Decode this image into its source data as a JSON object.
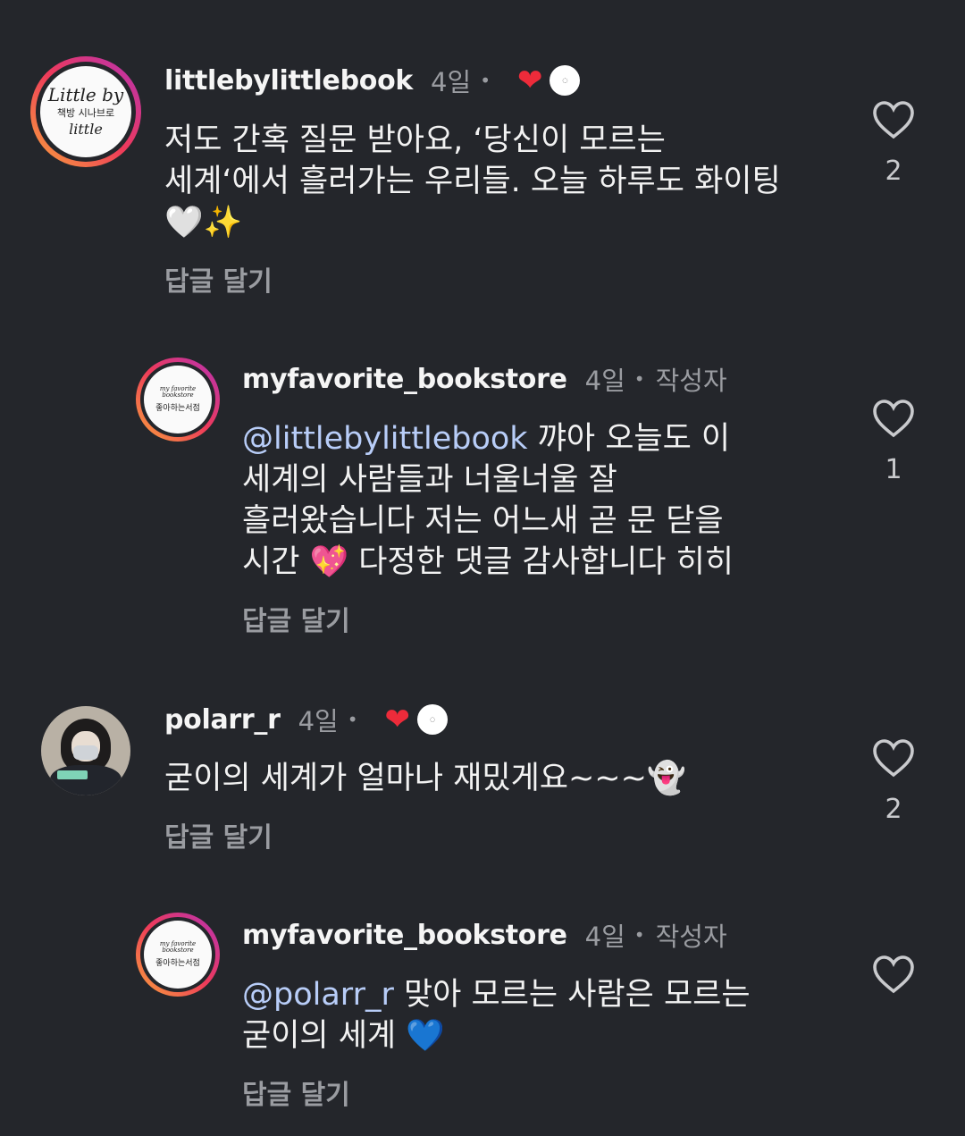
{
  "comments": [
    {
      "username": "littlebylittlebook",
      "time": "4일",
      "liked_by_author": true,
      "avatar_text_1": "Little by",
      "avatar_text_2": "책방 시나브로",
      "avatar_text_3": "little",
      "text": "저도 간혹 질문 받아요, ‘당신이 모르는\n세계‘에서 흘러가는 우리들. 오늘 하루도 화이팅\n🤍✨",
      "reply_label": "답글 달기",
      "like_count": "2"
    },
    {
      "username": "myfavorite_bookstore",
      "time": "4일",
      "author_label": "작성자",
      "avatar_text_1": "my favorite bookstore",
      "avatar_text_2": "좋아하는서점",
      "mention": "@littlebylittlebook",
      "text": " 꺄아 오늘도 이\n세계의 사람들과 너울너울 잘\n흘러왔습니다 저는 어느새 곧 문 닫을\n시간 💖 다정한 댓글 감사합니다 히히",
      "reply_label": "답글 달기",
      "like_count": "1"
    },
    {
      "username": "polarr_r",
      "time": "4일",
      "liked_by_author": true,
      "text": "굳이의 세계가 얼마나 재밌게요~~~👻",
      "reply_label": "답글 달기",
      "like_count": "2"
    },
    {
      "username": "myfavorite_bookstore",
      "time": "4일",
      "author_label": "작성자",
      "avatar_text_1": "my favorite bookstore",
      "avatar_text_2": "좋아하는서점",
      "mention": "@polarr_r",
      "text": " 맞아 모르는 사람은 모르는\n굳이의 세계 💙",
      "reply_label": "답글 달기",
      "like_count": ""
    }
  ],
  "icons": {
    "like": "heart-outline-icon",
    "liked_by_author": "heart-filled-icon"
  },
  "colors": {
    "background": "#24262b",
    "mention": "#b8cdf8",
    "author_heart": "#ed2b3a",
    "secondary_text": "#9a9ca1"
  }
}
